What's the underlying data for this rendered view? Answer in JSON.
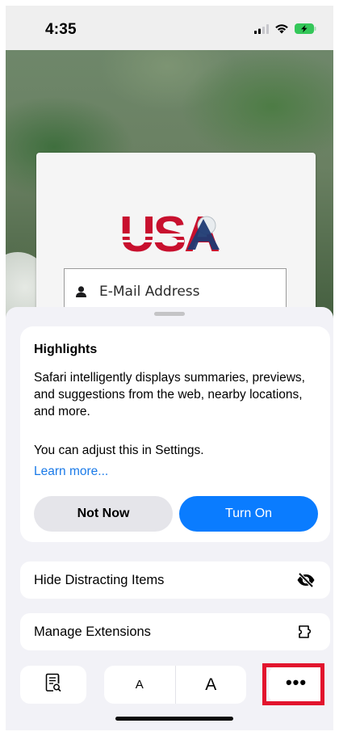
{
  "status_bar": {
    "time": "4:35",
    "signal_icon": "cellular-signal-icon",
    "wifi_icon": "wifi-icon",
    "battery_icon": "battery-charging-icon",
    "battery_color": "#34c759"
  },
  "webpage": {
    "logo_text": "USA",
    "email": {
      "placeholder": "E-Mail Address",
      "value": ""
    }
  },
  "highlights": {
    "title": "Highlights",
    "description": "Safari intelligently displays summaries, previews, and suggestions from the web, nearby locations, and more.",
    "settings_note": "You can adjust this in Settings.",
    "learn_more": "Learn more...",
    "not_now_label": "Not Now",
    "turn_on_label": "Turn On",
    "accent_color": "#0a7cff"
  },
  "menu": {
    "hide_distracting": {
      "label": "Hide Distracting Items",
      "icon": "eye-slash-icon"
    },
    "manage_extensions": {
      "label": "Manage Extensions",
      "icon": "extension-puzzle-icon"
    }
  },
  "toolbar": {
    "reader_icon": "reader-search-icon",
    "font_smaller_label": "A",
    "font_larger_label": "A",
    "more_label": "•••",
    "highlight_color": "#e2142d"
  }
}
